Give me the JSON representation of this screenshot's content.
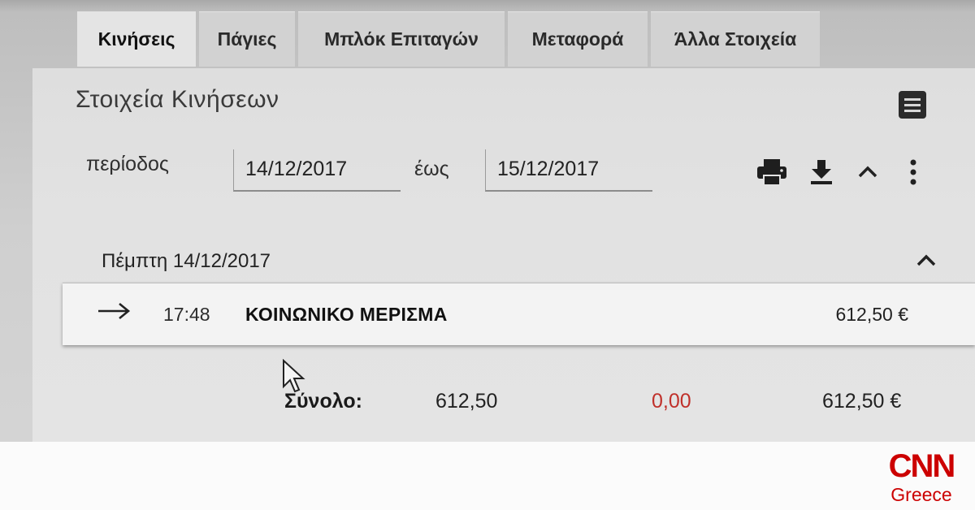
{
  "tabs": [
    {
      "label": "Κινήσεις",
      "active": true
    },
    {
      "label": "Πάγιες",
      "active": false
    },
    {
      "label": "Μπλόκ Επιταγών",
      "active": false
    },
    {
      "label": "Μεταφορά",
      "active": false
    },
    {
      "label": "Άλλα Στοιχεία",
      "active": false
    }
  ],
  "section": {
    "title": "Στοιχεία Κινήσεων",
    "menu_icon": "hamburger-menu-icon"
  },
  "filters": {
    "period_label": "περίοδος",
    "from_date": "14/12/2017",
    "to_label": "έως",
    "to_date": "15/12/2017"
  },
  "toolbar": {
    "icons": [
      "print-icon",
      "download-icon",
      "chevron-up-icon",
      "more-vertical-icon"
    ]
  },
  "day_group": {
    "heading": "Πέμπτη 14/12/2017",
    "collapse_icon": "chevron-up-icon"
  },
  "transactions": [
    {
      "direction_icon": "arrow-right-icon",
      "time": "17:48",
      "description": "ΚΟΙΝΩΝΙΚΟ ΜΕΡΙΣΜΑ",
      "amount": "612,50 €"
    }
  ],
  "totals": {
    "label": "Σύνολο:",
    "credit": "612,50",
    "debit": "0,00",
    "balance": "612,50 €"
  },
  "logo": {
    "top": "CNN",
    "bottom": "Greece"
  },
  "colors": {
    "debit": "#c0302a",
    "logo_red": "#cc0000"
  }
}
